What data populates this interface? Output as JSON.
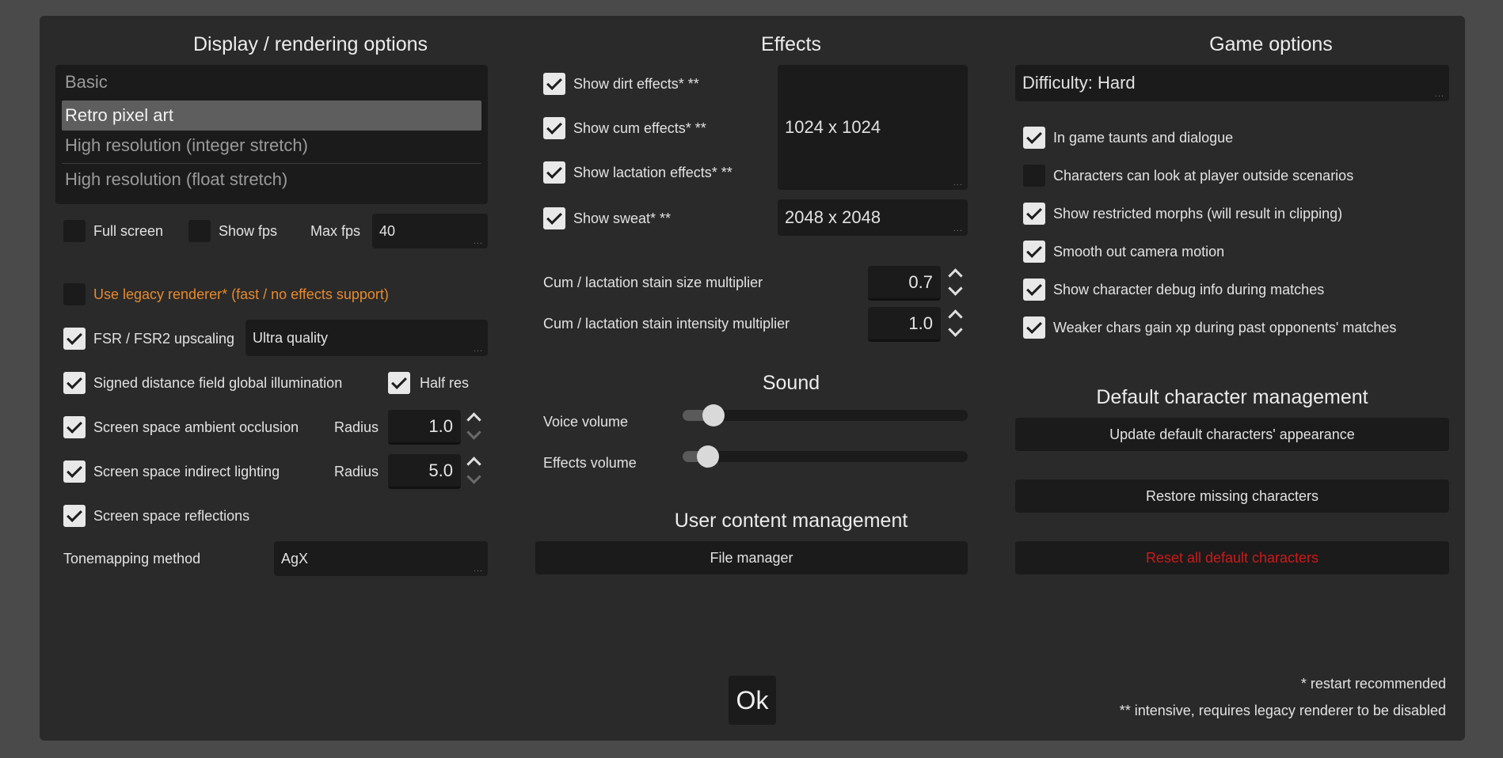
{
  "display": {
    "heading": "Display / rendering options",
    "render_modes": [
      "Basic",
      "Retro pixel art",
      "High resolution (integer stretch)",
      "High resolution (float stretch)"
    ],
    "selected_mode": "Retro pixel art",
    "full_screen": {
      "label": "Full screen",
      "checked": false
    },
    "show_fps": {
      "label": "Show fps",
      "checked": false
    },
    "max_fps": {
      "label": "Max fps",
      "value": "40"
    },
    "legacy_renderer": {
      "label": "Use legacy renderer* (fast / no effects support)",
      "checked": false
    },
    "fsr": {
      "label": "FSR / FSR2 upscaling",
      "checked": true,
      "value": "Ultra quality"
    },
    "sdfgi": {
      "label": "Signed distance field global illumination",
      "checked": true
    },
    "half_res": {
      "label": "Half res",
      "checked": true
    },
    "ssao": {
      "label": "Screen space ambient occlusion",
      "checked": true,
      "radius_label": "Radius",
      "radius": "1.0"
    },
    "ssil": {
      "label": "Screen space indirect lighting",
      "checked": true,
      "radius_label": "Radius",
      "radius": "5.0"
    },
    "ssr": {
      "label": "Screen space reflections",
      "checked": true
    },
    "tonemapping": {
      "label": "Tonemapping method",
      "value": "AgX"
    }
  },
  "effects": {
    "heading": "Effects",
    "dirt": {
      "label": "Show dirt effects* **",
      "checked": true
    },
    "cum": {
      "label": "Show cum effects* **",
      "checked": true
    },
    "lactation": {
      "label": "Show lactation effects* **",
      "checked": true
    },
    "sweat": {
      "label": "Show sweat* **",
      "checked": true
    },
    "texture_size_1": "1024 x 1024",
    "texture_size_2": "2048 x 2048",
    "stain_size": {
      "label": "Cum / lactation stain size multiplier",
      "value": "0.7"
    },
    "stain_intensity": {
      "label": "Cum / lactation stain intensity multiplier",
      "value": "1.0"
    }
  },
  "sound": {
    "heading": "Sound",
    "voice": {
      "label": "Voice volume",
      "level": 0.07
    },
    "effects": {
      "label": "Effects volume",
      "level": 0.05
    }
  },
  "user_content": {
    "heading": "User content management",
    "file_manager": "File manager"
  },
  "game": {
    "heading": "Game options",
    "difficulty": "Difficulty: Hard",
    "taunts": {
      "label": "In game taunts and dialogue",
      "checked": true
    },
    "look_at_player": {
      "label": "Characters can look at player outside scenarios",
      "checked": false
    },
    "restricted_morphs": {
      "label": "Show restricted morphs (will result in clipping)",
      "checked": true
    },
    "smooth_camera": {
      "label": "Smooth out camera motion",
      "checked": true
    },
    "debug_info": {
      "label": "Show character debug info during matches",
      "checked": true
    },
    "weaker_xp": {
      "label": "Weaker chars gain xp during past opponents' matches",
      "checked": true
    }
  },
  "default_chars": {
    "heading": "Default character management",
    "update": "Update default characters' appearance",
    "restore": "Restore missing characters",
    "reset": "Reset all default characters"
  },
  "footer": {
    "ok": "Ok",
    "note1": "* restart recommended",
    "note2": "** intensive, requires legacy renderer to be disabled"
  },
  "colors": {
    "warning": "#e68a2e",
    "danger": "#cc1a1a",
    "panel": "#2a2a2a",
    "field": "#1b1b1b"
  }
}
